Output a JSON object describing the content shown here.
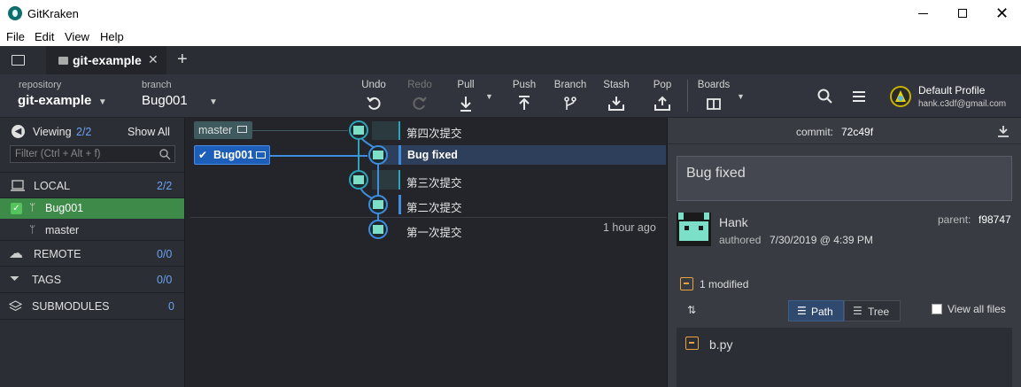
{
  "app": {
    "title": "GitKraken"
  },
  "menu": [
    "File",
    "Edit",
    "View",
    "Help"
  ],
  "tabs": {
    "active": "git-example"
  },
  "toolbar": {
    "repository_caption": "repository",
    "repository_name": "git-example",
    "branch_caption": "branch",
    "branch_name": "Bug001",
    "undo": "Undo",
    "redo": "Redo",
    "pull": "Pull",
    "push": "Push",
    "branch": "Branch",
    "stash": "Stash",
    "pop": "Pop",
    "boards": "Boards",
    "profile_name": "Default Profile",
    "profile_email": "hank.c3df@gmail.com"
  },
  "sidebar": {
    "viewing_label": "Viewing",
    "viewing_count": "2/2",
    "show_all": "Show All",
    "filter_placeholder": "Filter (Ctrl + Alt + f)",
    "local_label": "LOCAL",
    "local_count": "2/2",
    "branches": [
      "Bug001",
      "master"
    ],
    "remote_label": "REMOTE",
    "remote_count": "0/0",
    "tags_label": "TAGS",
    "tags_count": "0/0",
    "submodules_label": "SUBMODULES",
    "submodules_count": "0"
  },
  "graph": {
    "master_ref": "master",
    "bug_ref": "Bug001",
    "commits": [
      "第四次提交",
      "Bug fixed",
      "第三次提交",
      "第二次提交",
      "第一次提交"
    ],
    "last_time": "1 hour ago"
  },
  "detail": {
    "commit_label": "commit:",
    "commit_hash": "72c49f",
    "message": "Bug fixed",
    "author": "Hank",
    "authored_label": "authored",
    "authored_date": "7/30/2019 @ 4:39 PM",
    "parent_label": "parent:",
    "parent_hash": "f98747",
    "modified": "1 modified",
    "path_label": "Path",
    "tree_label": "Tree",
    "view_all_label": "View all files",
    "file": "b.py"
  },
  "colors": {
    "accent": "#3d8ee0",
    "active_branch_bg": "#3d8a4a",
    "node": "#2fa3b8",
    "modified": "#e8a33d"
  }
}
